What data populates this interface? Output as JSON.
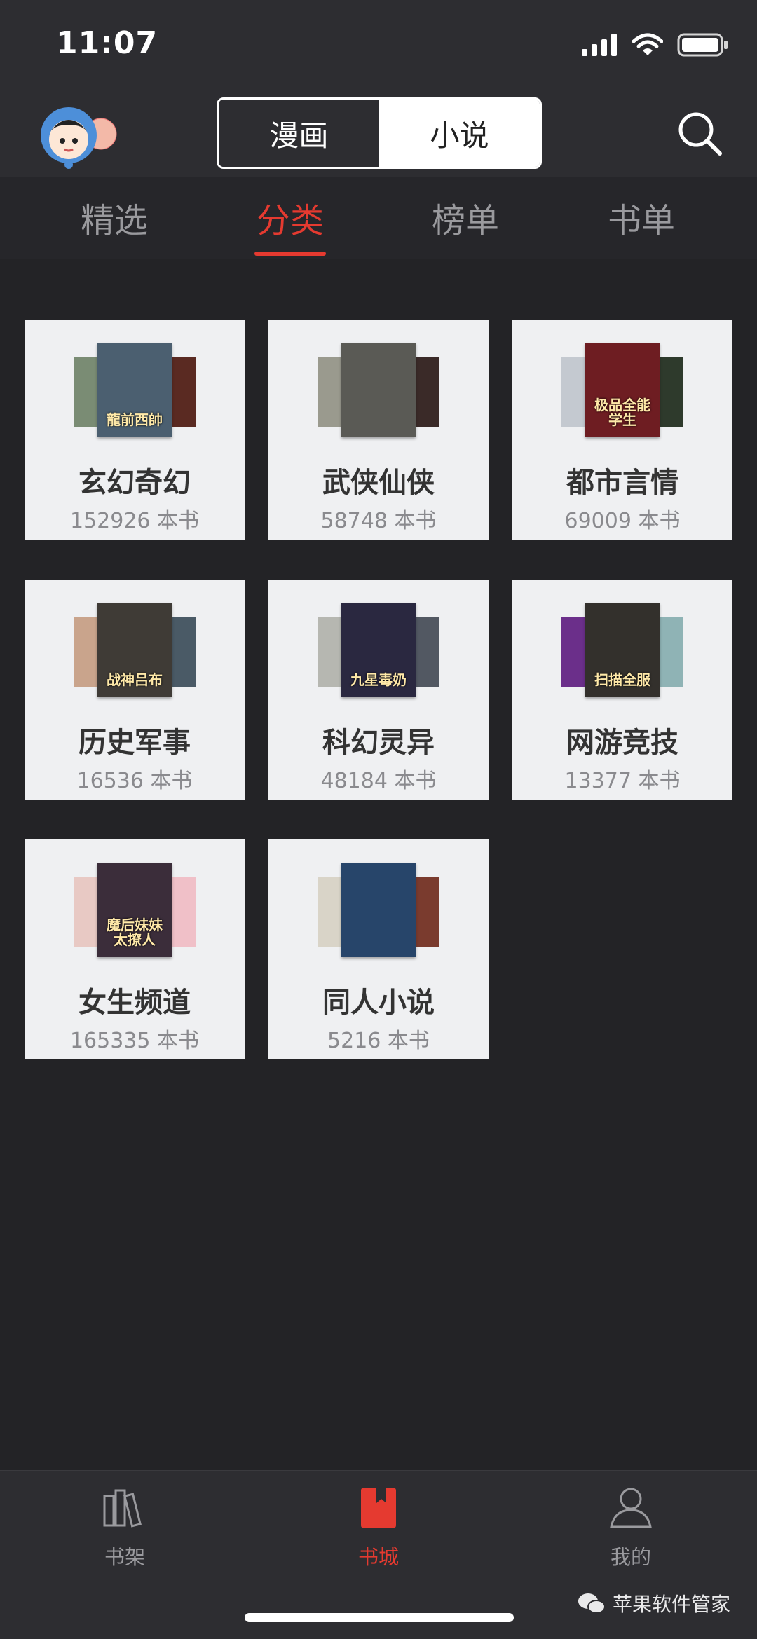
{
  "status_bar": {
    "time": "11:07"
  },
  "header": {
    "mode_tabs": [
      {
        "label": "漫画"
      },
      {
        "label": "小说"
      }
    ],
    "selected_mode": "小说"
  },
  "tabs": [
    {
      "label": "精选"
    },
    {
      "label": "分类"
    },
    {
      "label": "榜单"
    },
    {
      "label": "书单"
    }
  ],
  "active_tab": "分类",
  "categories": [
    {
      "name": "玄幻奇幻",
      "count": "152926 本书",
      "cover_text": "龍前西帥",
      "cover_color": "#4b5f70"
    },
    {
      "name": "武侠仙侠",
      "count": "58748 本书",
      "cover_text": "",
      "cover_color": "#5a5a55"
    },
    {
      "name": "都市言情",
      "count": "69009 本书",
      "cover_text": "极品全能学生",
      "cover_color": "#6e1d22"
    },
    {
      "name": "历史军事",
      "count": "16536 本书",
      "cover_text": "战神吕布",
      "cover_color": "#3f3b36"
    },
    {
      "name": "科幻灵异",
      "count": "48184 本书",
      "cover_text": "九星毒奶",
      "cover_color": "#2a2840"
    },
    {
      "name": "网游竞技",
      "count": "13377 本书",
      "cover_text": "扫描全服",
      "cover_color": "#33302c"
    },
    {
      "name": "女生频道",
      "count": "165335 本书",
      "cover_text": "魔后妹妹太撩人",
      "cover_color": "#3b2d3a"
    },
    {
      "name": "同人小说",
      "count": "5216 本书",
      "cover_text": "",
      "cover_color": "#27456a"
    }
  ],
  "bottom_nav": [
    {
      "label": "书架",
      "icon": "bookshelf-icon"
    },
    {
      "label": "书城",
      "icon": "bookstore-icon"
    },
    {
      "label": "我的",
      "icon": "profile-icon"
    }
  ],
  "active_nav": "书城",
  "watermark": "苹果软件管家",
  "colors": {
    "accent": "#e53a30",
    "background": "#232326",
    "card": "#eff0f2"
  }
}
